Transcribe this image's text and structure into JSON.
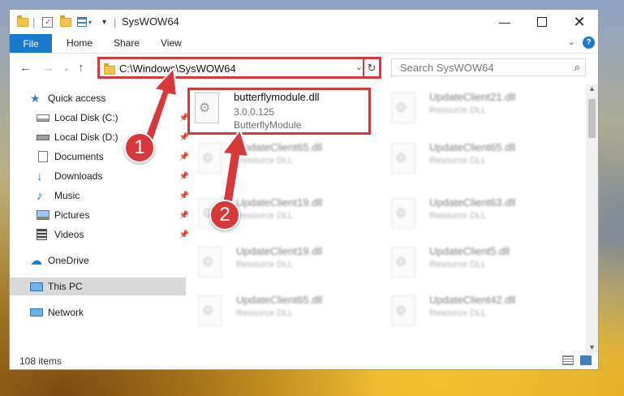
{
  "window": {
    "title": "SysWOW64"
  },
  "ribbon": {
    "tabs": [
      "File",
      "Home",
      "Share",
      "View"
    ],
    "help": "?"
  },
  "address": {
    "path": "C:\\Windows\\SysWOW64",
    "search_placeholder": "Search SysWOW64"
  },
  "nav": {
    "items": [
      {
        "label": "Quick access",
        "icon": "star-icon"
      },
      {
        "label": "Local Disk (C:)",
        "icon": "drive-icon",
        "pinned": true
      },
      {
        "label": "Local Disk (D:)",
        "icon": "drive-icon",
        "pinned": true
      },
      {
        "label": "Documents",
        "icon": "documents-icon",
        "pinned": true
      },
      {
        "label": "Downloads",
        "icon": "download-icon",
        "pinned": true
      },
      {
        "label": "Music",
        "icon": "music-icon",
        "pinned": true
      },
      {
        "label": "Pictures",
        "icon": "pictures-icon",
        "pinned": true
      },
      {
        "label": "Videos",
        "icon": "videos-icon",
        "pinned": true
      },
      {
        "label": "OneDrive",
        "icon": "cloud-icon"
      },
      {
        "label": "This PC",
        "icon": "computer-icon",
        "selected": true
      },
      {
        "label": "Network",
        "icon": "network-icon"
      }
    ]
  },
  "files": [
    {
      "name": "butterflymodule.dll",
      "version": "3.0.0.125",
      "desc": "ButterflyModule"
    },
    {
      "name": "UpdateClient21.dll",
      "desc": "Resource DLL"
    },
    {
      "name": "UpdateClient65.dll",
      "desc": "Resource DLL"
    },
    {
      "name": "UpdateClient65.dll",
      "desc": "Resource DLL"
    },
    {
      "name": "UpdateClient19.dll",
      "desc": "Resource DLL"
    },
    {
      "name": "UpdateClient63.dll",
      "desc": "Resource DLL"
    },
    {
      "name": "UpdateClient19.dll",
      "desc": "Resource DLL"
    },
    {
      "name": "UpdateClient5.dll",
      "desc": "Resource DLL"
    },
    {
      "name": "UpdateClient65.dll",
      "desc": "Resource DLL"
    },
    {
      "name": "UpdateClient42.dll",
      "desc": "Resource DLL"
    }
  ],
  "status": {
    "item_count": "108 items"
  },
  "annotations": {
    "step1": "1",
    "step2": "2"
  },
  "colors": {
    "accent": "#1979ca",
    "highlight": "#d9383b",
    "selected_bg": "#d9d9d9"
  }
}
